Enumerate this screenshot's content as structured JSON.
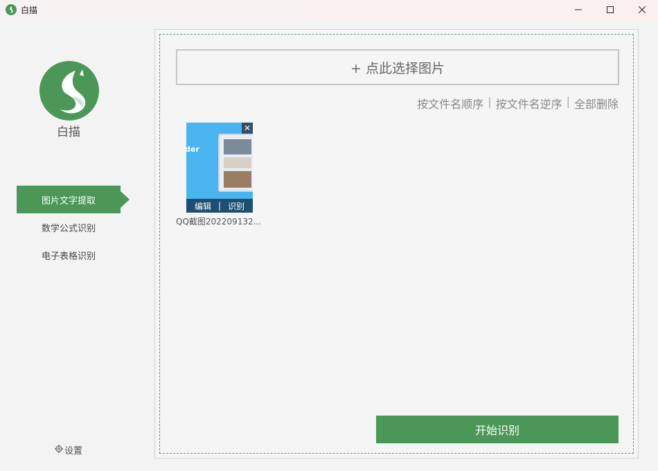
{
  "window": {
    "title": "白描"
  },
  "sidebar": {
    "logo_text": "白描",
    "items": [
      {
        "label": "图片文字提取",
        "active": true
      },
      {
        "label": "数学公式识别",
        "active": false
      },
      {
        "label": "电子表格识别",
        "active": false
      }
    ],
    "settings_label": "设置"
  },
  "main": {
    "select_button": "+ 点此选择图片",
    "sort_by_name_asc": "按文件名顺序",
    "sort_by_name_desc": "按文件名逆序",
    "delete_all": "全部删除",
    "separator": "|",
    "image": {
      "filename": "QQ截图202209132...",
      "edit_label": "编辑",
      "bar_separator": "|",
      "recognize_label": "识别",
      "close_glyph": "✕",
      "preview_text": "der"
    },
    "start_button": "开始识别"
  },
  "colors": {
    "accent": "#4a9757",
    "thumb_bar": "#1e4f72"
  }
}
